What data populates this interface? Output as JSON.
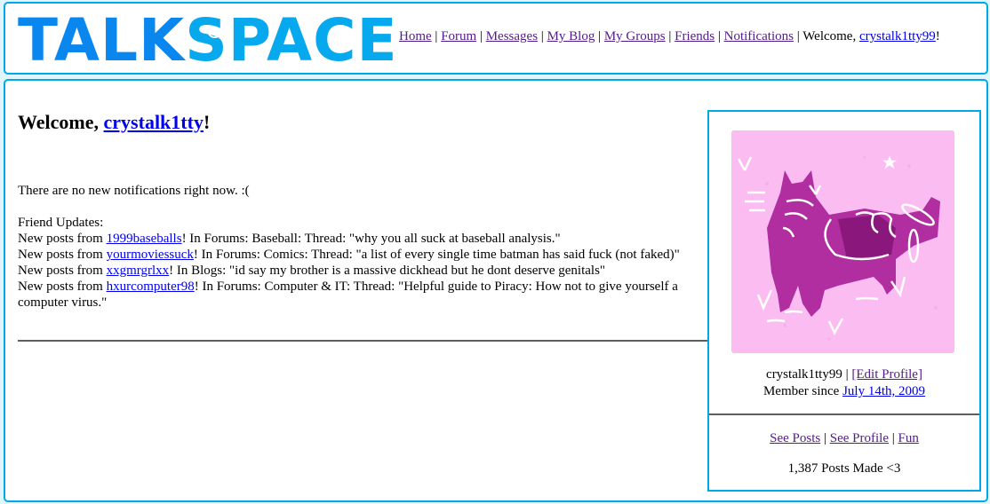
{
  "header": {
    "logo": {
      "part1": "TALK",
      "part2": "SPACE"
    },
    "nav": [
      {
        "label": "Home"
      },
      {
        "label": "Forum"
      },
      {
        "label": "Messages"
      },
      {
        "label": "My Blog"
      },
      {
        "label": "My Groups"
      },
      {
        "label": "Friends"
      },
      {
        "label": "Notifications"
      }
    ],
    "separator": " | ",
    "welcome_prefix": "Welcome, ",
    "username": "crystalk1tty99",
    "welcome_suffix": "!"
  },
  "main": {
    "title_prefix": "Welcome, ",
    "title_user": "crystalk1tty",
    "title_suffix": "!",
    "notifications_text": "There are no new notifications right now. :(",
    "friend_updates_heading": "Friend Updates:",
    "updates": [
      {
        "prefix": "New posts from ",
        "user": "1999baseballs",
        "text": "! In Forums: Baseball: Thread: \"why you all suck at baseball analysis.\""
      },
      {
        "prefix": "New posts from ",
        "user": "yourmoviessuck",
        "text": "! In Forums: Comics: Thread: \"a list of every single time batman has said fuck (not faked)\""
      },
      {
        "prefix": "New posts from ",
        "user": "xxgmrgrlxx",
        "text": "! In Blogs: \"id say my brother is a massive dickhead but he dont deserve genitals\""
      },
      {
        "prefix": "New posts from ",
        "user": "hxurcomputer98",
        "text": "! In Forums: Computer & IT: Thread: \"Helpful guide to Piracy: How not to give yourself a computer virus.\""
      }
    ]
  },
  "profile": {
    "avatar_alt": "pink cat avatar with hearts and stars",
    "username": "crystalk1tty99",
    "edit_profile": "[Edit Profile]",
    "member_since_label": "Member since ",
    "member_since_date": "July 14th, 2009",
    "links": [
      {
        "label": "See Posts"
      },
      {
        "label": "See Profile"
      },
      {
        "label": "Fun"
      }
    ],
    "post_count": "1,387 Posts Made <3"
  }
}
